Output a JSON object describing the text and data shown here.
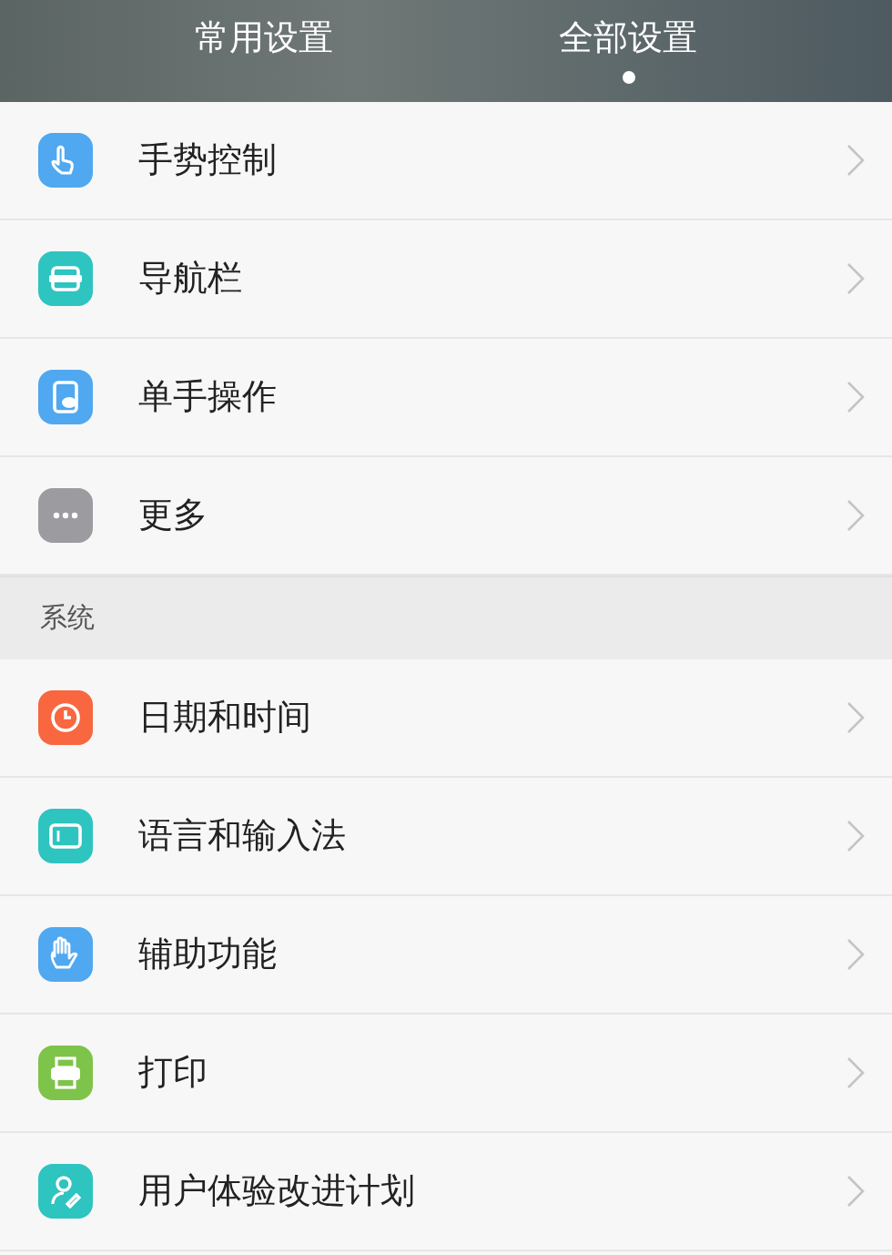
{
  "tabs": [
    {
      "label": "常用设置",
      "selected": false
    },
    {
      "label": "全部设置",
      "selected": true
    }
  ],
  "sections": [
    {
      "items": [
        {
          "label": "手势控制",
          "color": "#4fa8f0"
        },
        {
          "label": "导航栏",
          "color": "#2ec4c0"
        },
        {
          "label": "单手操作",
          "color": "#4fa8f0"
        },
        {
          "label": "更多",
          "color": "#9b9ba0"
        }
      ]
    },
    {
      "title": "系统",
      "items": [
        {
          "label": "日期和时间",
          "color": "#f8673f"
        },
        {
          "label": "语言和输入法",
          "color": "#2ec4c0"
        },
        {
          "label": "辅助功能",
          "color": "#4fa8f0"
        },
        {
          "label": "打印",
          "color": "#7ec34a"
        },
        {
          "label": "用户体验改进计划",
          "color": "#2ec4c0"
        }
      ]
    }
  ]
}
